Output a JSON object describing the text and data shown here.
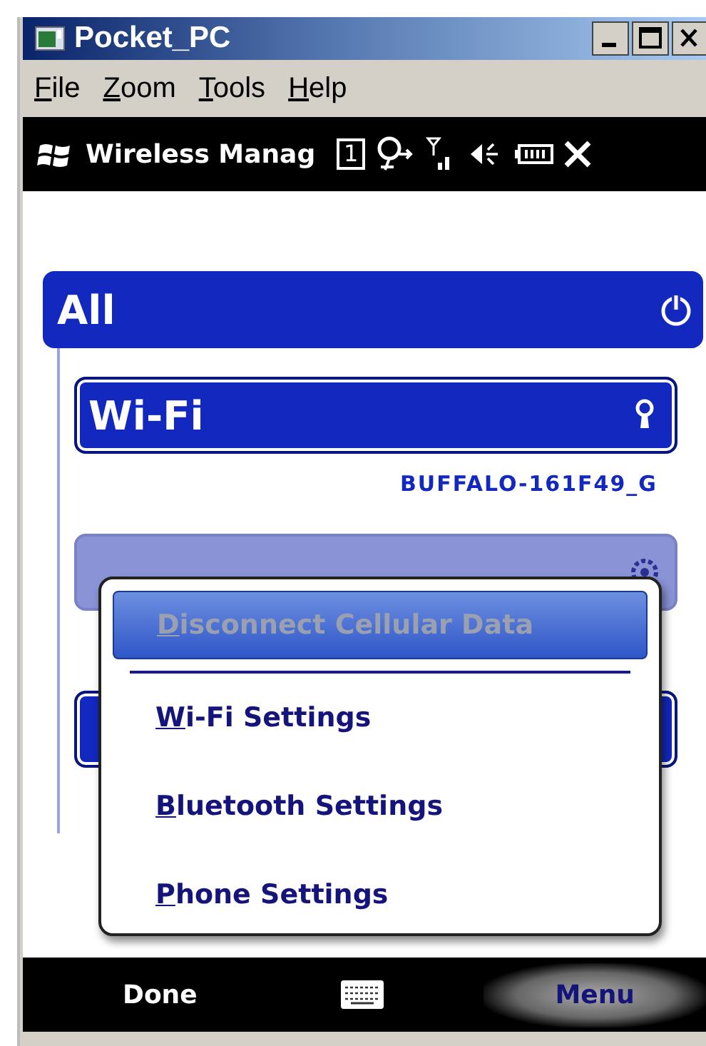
{
  "window": {
    "title": "Pocket_PC"
  },
  "menu_bar": [
    {
      "key": "F",
      "rest": "ile"
    },
    {
      "key": "Z",
      "rest": "oom"
    },
    {
      "key": "T",
      "rest": "ools"
    },
    {
      "key": "H",
      "rest": "elp"
    }
  ],
  "device_bar": {
    "title": "Wireless Manag",
    "notification_count": "1"
  },
  "sections": [
    {
      "kind": "header",
      "label": "All"
    },
    {
      "kind": "device",
      "label": "Wi-Fi",
      "disabled": false,
      "network": "BUFFALO-161F49_G"
    },
    {
      "kind": "device",
      "disabled": true
    },
    {
      "kind": "device",
      "disabled": false
    }
  ],
  "context_menu": {
    "items": [
      {
        "key": "D",
        "rest": "isconnect Cellular Data",
        "selected": true,
        "disabled": true,
        "separator_after": true
      },
      {
        "key": "W",
        "rest": "i-Fi Settings",
        "selected": false,
        "disabled": false,
        "separator_after": false
      },
      {
        "key": "B",
        "rest": "luetooth Settings",
        "selected": false,
        "disabled": false,
        "separator_after": false
      },
      {
        "key": "P",
        "rest": "hone Settings",
        "selected": false,
        "disabled": false,
        "separator_after": false
      }
    ]
  },
  "softkeys": {
    "left": {
      "label": "Done",
      "pressed": false
    },
    "right": {
      "label": "Menu",
      "pressed": true
    }
  }
}
